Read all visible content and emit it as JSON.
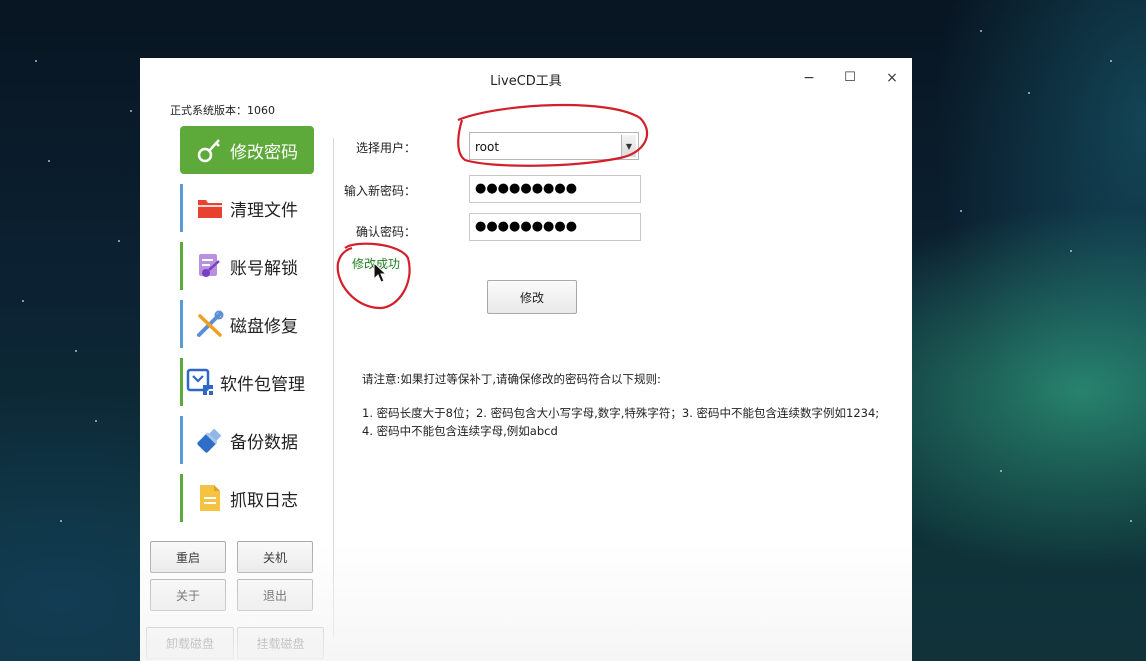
{
  "window": {
    "title": "LiveCD工具",
    "controls": {
      "minimize": "−",
      "maximize": "☐",
      "close": "×"
    }
  },
  "version_label": "正式系统版本：1060",
  "sidebar": {
    "items": [
      {
        "label": "修改密码",
        "icon": "key-icon",
        "active": true
      },
      {
        "label": "清理文件",
        "icon": "folder-icon",
        "accent": "#5b9bd5"
      },
      {
        "label": "账号解锁",
        "icon": "unlock-account-icon",
        "accent": "#5daa3a"
      },
      {
        "label": "磁盘修复",
        "icon": "wrench-icon",
        "accent": "#5b9bd5"
      },
      {
        "label": "软件包管理",
        "icon": "package-icon",
        "accent": "#5daa3a"
      },
      {
        "label": "备份数据",
        "icon": "usb-drive-icon",
        "accent": "#5b9bd5"
      },
      {
        "label": "抓取日志",
        "icon": "document-icon",
        "accent": "#5daa3a"
      }
    ],
    "buttons": {
      "restart": "重启",
      "shutdown": "关机",
      "about": "关于",
      "exit": "退出",
      "unmount": "卸载磁盘",
      "mount": "挂载磁盘"
    }
  },
  "form": {
    "user_label": "选择用户：",
    "user_value": "root",
    "new_password_label": "输入新密码：",
    "new_password_value": "●●●●●●●●●",
    "confirm_label": "确认密码：",
    "confirm_value": "●●●●●●●●●",
    "status_message": "修改成功",
    "submit_label": "修改"
  },
  "notes": {
    "heading": "请注意:如果打过等保补丁,请确保修改的密码符合以下规则:",
    "line1": "1. 密码长度大于8位；2. 密码包含大小写字母,数字,特殊字符；3. 密码中不能包含连续数字例如1234;",
    "line2": "4. 密码中不能包含连续字母,例如abcd"
  },
  "colors": {
    "active_nav": "#5daa3a",
    "success_text": "#1e7d1e",
    "annotation": "#d21f2a"
  }
}
